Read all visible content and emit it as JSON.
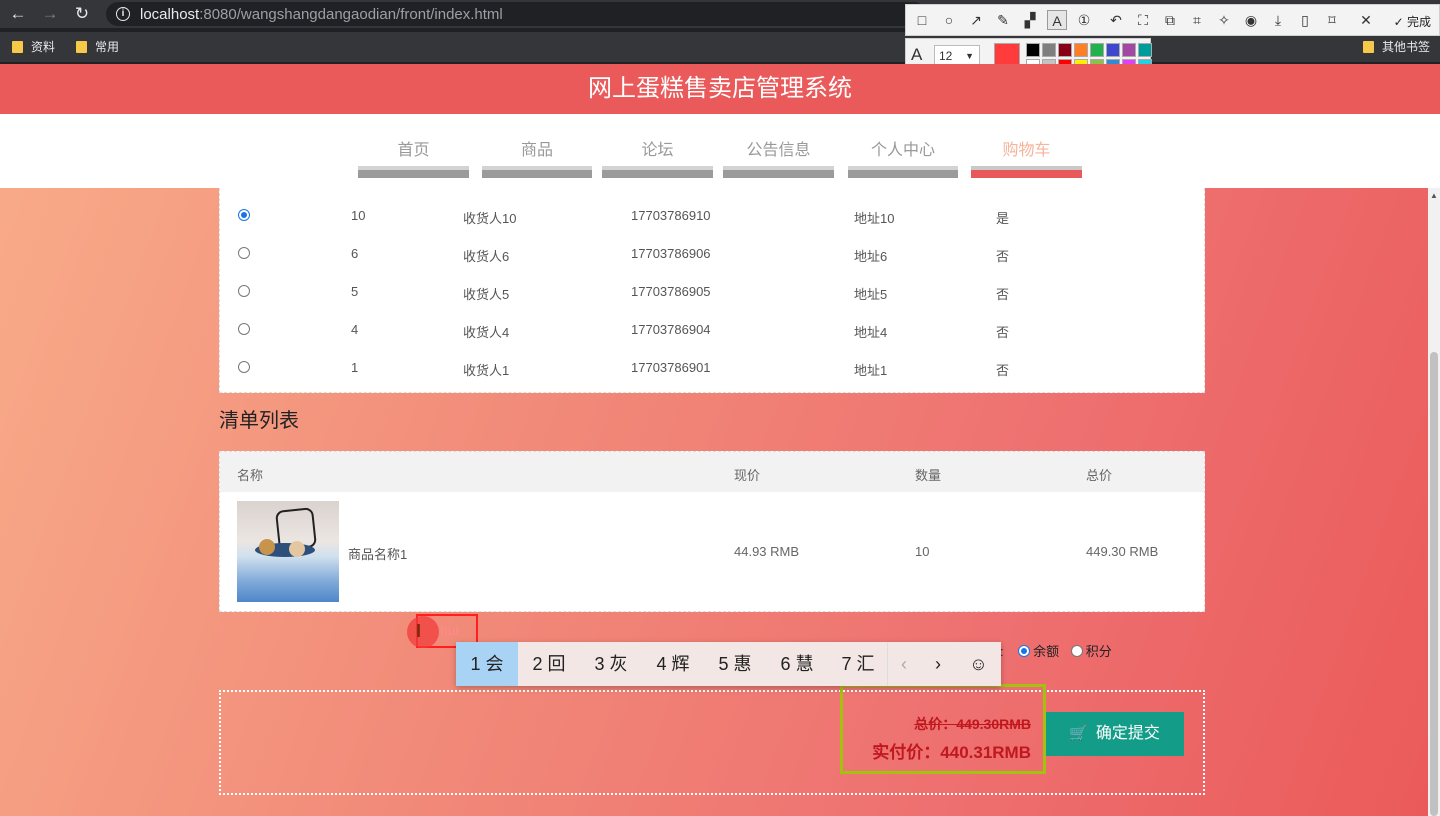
{
  "browser": {
    "url_host": "localhost",
    "url_rest": ":8080/wangshangdangaodian/front/index.html",
    "bookmarks": [
      "资料",
      "常用"
    ],
    "other_bookmarks": "其他书签"
  },
  "snip_tool": {
    "done_label": "完成",
    "font_size": "12",
    "current_color": "#ff3b3b",
    "palette": [
      "#000000",
      "#7f7f7f",
      "#880015",
      "#ff7f27",
      "#22b14c",
      "#3f48cc",
      "#a349a4",
      "#009b9b",
      "#ffffff",
      "#c3c3c3",
      "#ff0000",
      "#fff200",
      "#8bc34a",
      "#2f8bd8",
      "#e040fb",
      "#22d3e6"
    ]
  },
  "site": {
    "title": "网上蛋糕售卖店管理系统",
    "nav": [
      "首页",
      "商品",
      "论坛",
      "公告信息",
      "个人中心",
      "购物车"
    ],
    "active_nav": "购物车"
  },
  "addresses": [
    {
      "id": "10",
      "name": "收货人10",
      "phone": "17703786910",
      "address": "地址10",
      "default": "是",
      "selected": true
    },
    {
      "id": "6",
      "name": "收货人6",
      "phone": "17703786906",
      "address": "地址6",
      "default": "否",
      "selected": false
    },
    {
      "id": "5",
      "name": "收货人5",
      "phone": "17703786905",
      "address": "地址5",
      "default": "否",
      "selected": false
    },
    {
      "id": "4",
      "name": "收货人4",
      "phone": "17703786904",
      "address": "地址4",
      "default": "否",
      "selected": false
    },
    {
      "id": "1",
      "name": "收货人1",
      "phone": "17703786901",
      "address": "地址1",
      "default": "否",
      "selected": false
    }
  ],
  "order": {
    "section_title": "清单列表",
    "headers": {
      "name": "名称",
      "price": "现价",
      "qty": "数量",
      "total": "总价"
    },
    "items": [
      {
        "name": "商品名称1",
        "price": "44.93 RMB",
        "qty": "10",
        "total": "449.30 RMB"
      }
    ]
  },
  "payment": {
    "label_suffix": ":",
    "options": [
      {
        "label": "余额",
        "selected": true
      },
      {
        "label": "积分",
        "selected": false
      }
    ]
  },
  "summary": {
    "total_label": "总价：449.30RMB",
    "real_label": "实付价：440.31RMB",
    "submit_label": "确定提交"
  },
  "ime": {
    "typed": "hui",
    "candidates": [
      "1 会",
      "2 回",
      "3 灰",
      "4 辉",
      "5 惠",
      "6 慧",
      "7 汇"
    ]
  }
}
